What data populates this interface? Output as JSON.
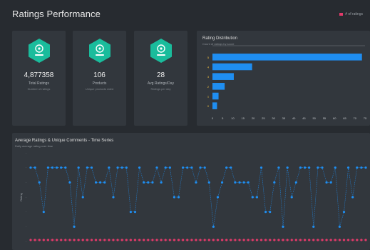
{
  "header": {
    "title": "Ratings Performance",
    "legend_label": "# of ratings",
    "legend_color": "#e23a6a"
  },
  "stats": [
    {
      "value": "4,877358",
      "label": "Total Ratings",
      "sub": "Number of ratings",
      "icon": "ratings-icon"
    },
    {
      "value": "106",
      "label": "Products",
      "sub": "Unique products rated",
      "icon": "products-icon"
    },
    {
      "value": "28",
      "label": "Avg Ratings/Day",
      "sub": "Ratings per day",
      "icon": "rating-day-icon"
    }
  ],
  "colors": {
    "accent": "#1f8ef1",
    "icon_bg": "#1abc9c",
    "pink": "#e23a6a",
    "panel": "#32373d",
    "background": "#272b30"
  },
  "chart_data": [
    {
      "type": "bar",
      "orientation": "horizontal",
      "title": "Rating Distribution",
      "subtitle": "Count of ratings by score",
      "categories": [
        "5",
        "4",
        "3",
        "2",
        "1",
        "0"
      ],
      "values": [
        98,
        26,
        14,
        8,
        4,
        3
      ],
      "xticks": [
        "0",
        "5",
        "10",
        "15",
        "20",
        "25",
        "30",
        "35",
        "40",
        "45",
        "50",
        "55",
        "60",
        "65",
        "70",
        "75"
      ],
      "xlim": [
        0,
        100
      ]
    },
    {
      "type": "scatter",
      "title": "Average Ratings & Unique Comments - Time Series",
      "subtitle": "Daily average rating over time",
      "ylabel": "Rating",
      "series": [
        {
          "color": "#1f8ef1",
          "values": [
            5,
            5,
            4,
            2,
            5,
            5,
            5,
            5,
            5,
            4,
            1,
            5,
            3,
            5,
            5,
            4,
            4,
            4,
            5,
            3,
            5,
            5,
            5,
            2,
            2,
            5,
            4,
            4,
            4,
            5,
            4,
            5,
            5,
            3,
            3,
            5,
            5,
            5,
            4,
            5,
            5,
            4,
            1,
            3,
            4,
            5,
            5,
            4,
            4,
            4,
            4,
            3,
            3,
            5,
            2,
            2,
            4,
            5,
            1,
            5,
            3,
            4,
            5,
            5,
            5,
            1,
            5,
            5,
            4,
            4,
            5,
            1,
            2,
            5,
            3,
            5,
            5,
            5
          ]
        },
        {
          "color": "#e23a6a",
          "values": [
            0,
            0,
            0,
            0,
            0,
            0,
            0,
            0,
            0,
            0,
            0,
            0,
            0,
            0,
            0,
            0,
            0,
            0,
            0,
            0,
            0,
            0,
            0,
            0,
            0,
            0,
            0,
            0,
            0,
            0,
            0,
            0,
            0,
            0,
            0,
            0,
            0,
            0,
            0,
            0,
            0,
            0,
            0,
            0,
            0,
            0,
            0,
            0,
            0,
            0,
            0,
            0,
            0,
            0,
            0,
            0,
            0,
            0,
            0,
            0,
            0,
            0,
            0,
            0,
            0,
            0,
            0,
            0,
            0,
            0,
            0,
            0,
            0,
            0,
            0,
            0,
            0,
            0
          ]
        }
      ],
      "ylim": [
        0,
        6
      ]
    }
  ]
}
